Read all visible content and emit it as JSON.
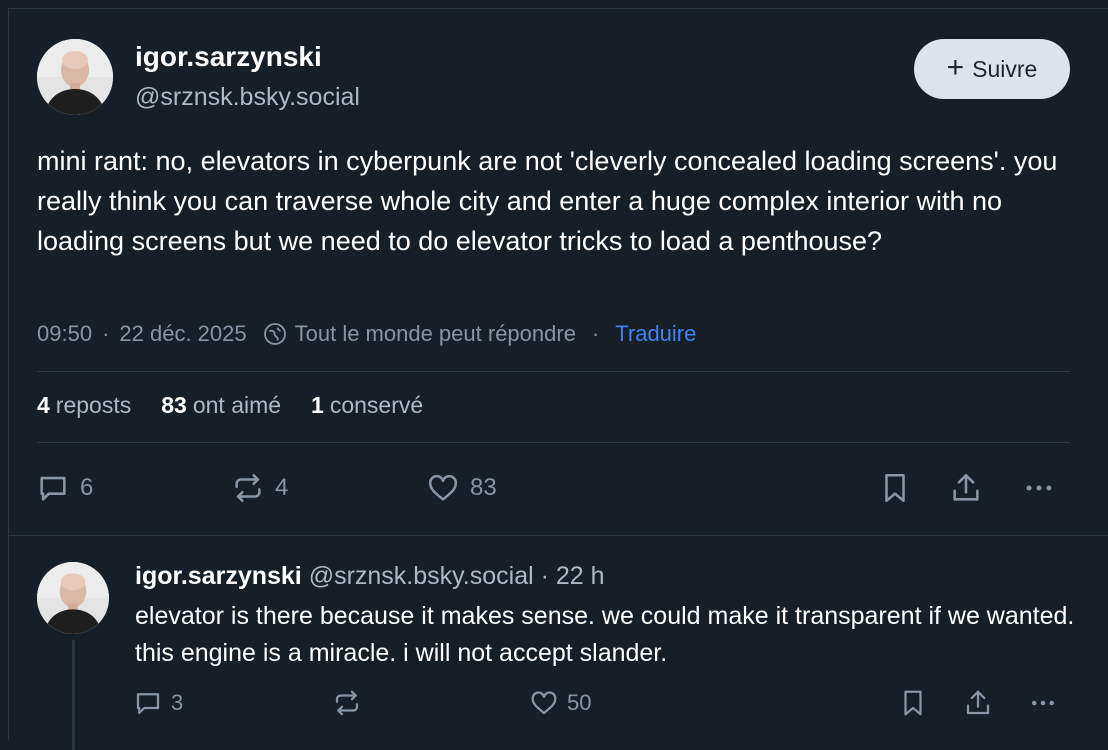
{
  "post": {
    "author_name": "igor.sarzynski",
    "author_handle": "@srznsk.bsky.social",
    "follow_label": "Suivre",
    "text": "mini rant: no, elevators in cyberpunk are not 'cleverly concealed loading screens'. you really think you can traverse whole city and enter a huge complex interior with no loading screens but we need to do elevator tricks to load a penthouse?",
    "time": "09:50",
    "date": "22 déc. 2025",
    "reply_permission": "Tout le monde peut répondre",
    "translate_label": "Traduire",
    "stats": {
      "reposts_count": "4",
      "reposts_label": "reposts",
      "likes_count": "83",
      "likes_label": "ont aimé",
      "saves_count": "1",
      "saves_label": "conservé"
    },
    "actions": {
      "reply_count": "6",
      "repost_count": "4",
      "like_count": "83"
    }
  },
  "reply": {
    "author_name": "igor.sarzynski",
    "author_handle": "@srznsk.bsky.social",
    "age": "22 h",
    "text": "elevator is there because it makes sense. we could make it transparent if we wanted. this engine is a miracle. i will not accept slander.",
    "actions": {
      "reply_count": "3",
      "repost_count": "",
      "like_count": "50"
    }
  },
  "icons": {
    "reply": "speech-bubble-icon",
    "repost": "repost-arrows-icon",
    "like": "heart-icon",
    "bookmark": "bookmark-icon",
    "share": "share-upload-icon",
    "more": "more-dots-icon",
    "reply_permission": "globe-reply-icon",
    "follow": "plus-icon"
  },
  "colors": {
    "background": "#161e27",
    "border": "#2c3846",
    "text_primary": "#ffffff",
    "text_secondary": "#8795a5",
    "link": "#3f84f0",
    "follow_button_bg": "#dde3ea"
  }
}
